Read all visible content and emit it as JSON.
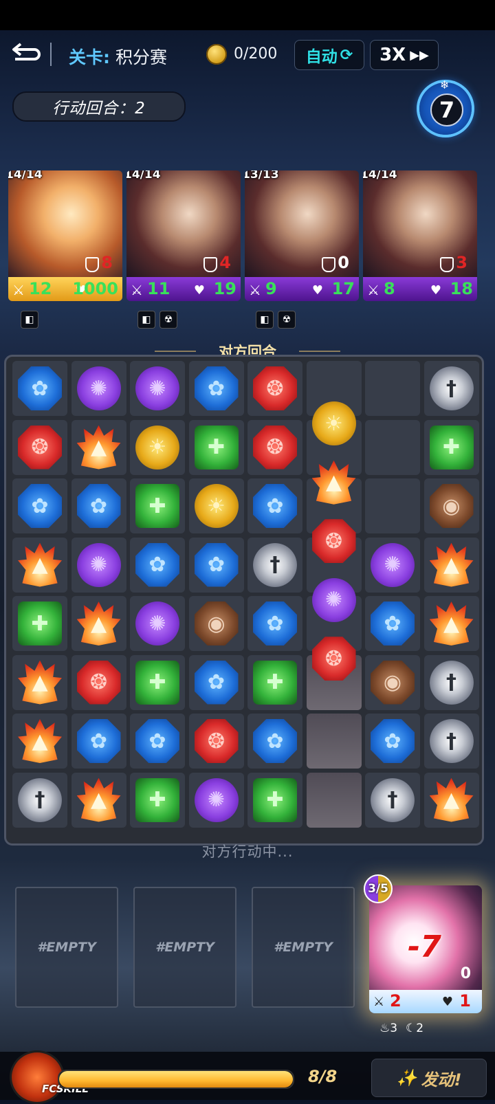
{
  "header": {
    "stage_key": "关卡:",
    "stage_value": "积分赛",
    "coins": "0/200",
    "auto_label": "自动",
    "speed_label": "3X"
  },
  "turn_label": "行动回合：2",
  "round_counter": "7",
  "cards": [
    {
      "count": "14/14",
      "shield": "8",
      "attack": "12",
      "hp": "1000",
      "shield_color": "#e02525",
      "hp_color": "#39e05a",
      "theme": "gold"
    },
    {
      "count": "14/14",
      "shield": "4",
      "attack": "11",
      "hp": "19",
      "shield_color": "#e02525",
      "hp_color": "#39e05a",
      "theme": "purple"
    },
    {
      "count": "13/13",
      "shield": "0",
      "attack": "9",
      "hp": "17",
      "shield_color": "#ffffff",
      "hp_color": "#39e05a",
      "theme": "purple"
    },
    {
      "count": "14/14",
      "shield": "3",
      "attack": "8",
      "hp": "18",
      "shield_color": "#e02525",
      "hp_color": "#39e05a",
      "theme": "purple"
    }
  ],
  "phase_label": "对方回合",
  "board": {
    "status": "对方行动中...",
    "rows": [
      [
        "blue",
        "purple",
        "purple",
        "blue",
        "red",
        "",
        "",
        "sword"
      ],
      [
        "red",
        "fire",
        "yellow",
        "green",
        "red",
        "",
        "",
        "green"
      ],
      [
        "blue",
        "blue",
        "green",
        "yellow",
        "blue",
        "",
        "",
        "brown"
      ],
      [
        "fire",
        "purple",
        "blue",
        "blue",
        "sword",
        "",
        "purple",
        "fire"
      ],
      [
        "green",
        "fire",
        "purple",
        "brown",
        "blue",
        "",
        "blue",
        "fire"
      ],
      [
        "fire",
        "red",
        "green",
        "blue",
        "green",
        "",
        "brown",
        "sword"
      ],
      [
        "fire",
        "blue",
        "blue",
        "red",
        "blue",
        "",
        "blue",
        "sword"
      ],
      [
        "sword",
        "fire",
        "green",
        "purple",
        "green",
        "",
        "sword",
        "fire"
      ]
    ],
    "falling": [
      {
        "type": "yellow",
        "row": 0.6
      },
      {
        "type": "fire",
        "row": 1.6
      },
      {
        "type": "red",
        "row": 2.6
      },
      {
        "type": "purple",
        "row": 3.6
      },
      {
        "type": "red",
        "row": 4.6
      }
    ]
  },
  "slots": [
    "#EMPTY",
    "#EMPTY",
    "#EMPTY"
  ],
  "skill_card": {
    "count": "3/5",
    "damage": "-7",
    "shield": "0",
    "attack": "2",
    "hp": "1",
    "mini_a": "3",
    "mini_b": "2"
  },
  "bottom": {
    "fcskill_label": "FCSKILL",
    "energy": "8/8",
    "energy_fraction": 1.0,
    "launch_label": "发动!"
  }
}
